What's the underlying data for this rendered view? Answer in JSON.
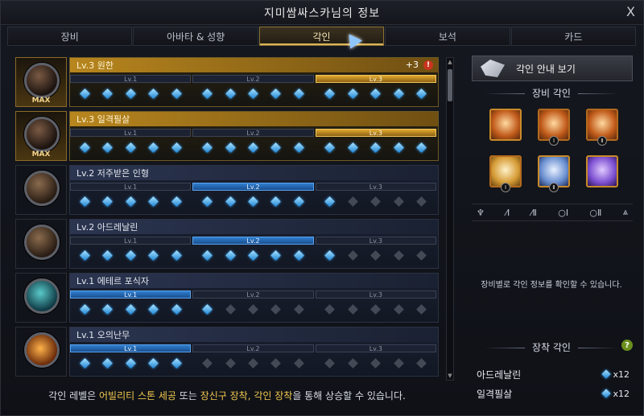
{
  "window": {
    "title": "지미쌈싸스카님의 정보",
    "close_glyph": "X"
  },
  "tabs": [
    {
      "label": "장비",
      "active": false
    },
    {
      "label": "아바타 & 성향",
      "active": false
    },
    {
      "label": "각인",
      "active": true
    },
    {
      "label": "보석",
      "active": false
    },
    {
      "label": "카드",
      "active": false
    }
  ],
  "engravings": [
    {
      "title": "Lv.3 원한",
      "bonus": "+3",
      "warn": "!",
      "max_label": "MAX",
      "levels": [
        "Lv.1",
        "Lv.2",
        "Lv.3"
      ]
    },
    {
      "title": "Lv.3 일격필살",
      "max_label": "MAX",
      "levels": [
        "Lv.1",
        "Lv.2",
        "Lv.3"
      ]
    },
    {
      "title": "Lv.2 저주받은 인형",
      "levels": [
        "Lv.1",
        "Lv.2",
        "Lv.3"
      ]
    },
    {
      "title": "Lv.2 아드레날린",
      "levels": [
        "Lv.1",
        "Lv.2",
        "Lv.3"
      ]
    },
    {
      "title": "Lv.1 에테르 포식자",
      "levels": [
        "Lv.1",
        "Lv.2",
        "Lv.3"
      ]
    },
    {
      "title": "Lv.1 오의난무",
      "levels": [
        "Lv.1",
        "Lv.2",
        "Lv.3"
      ]
    }
  ],
  "footer": {
    "pre": "각인 레벨은 ",
    "hl1": "어빌리티 스톤 세공",
    "mid1": " 또는 ",
    "hl2": "장신구 장착, 각인 장착",
    "post": "을 통해 상승할 수 있습니다."
  },
  "side": {
    "guide_button": "각인 안내 보기",
    "equip_section_title": "장비 각인",
    "slot_numerals": [
      "Ⅰ",
      "Ⅱ",
      "Ⅰ",
      "Ⅱ"
    ],
    "equip_icons": [
      "♆",
      "⁄Ⅰ",
      "⁄Ⅱ",
      "○Ⅰ",
      "○Ⅱ",
      "⩓"
    ],
    "note": "장비별로 각인 정보를 확인할 수 있습니다.",
    "equipped_title": "장착 각인",
    "help_glyph": "?",
    "equipped": [
      {
        "name": "아드레날린",
        "count": "x12"
      },
      {
        "name": "일격필살",
        "count": "x12"
      }
    ]
  },
  "colors": {
    "accent_gold": "#d9b55a",
    "active_blue": "#2f7fd0"
  }
}
